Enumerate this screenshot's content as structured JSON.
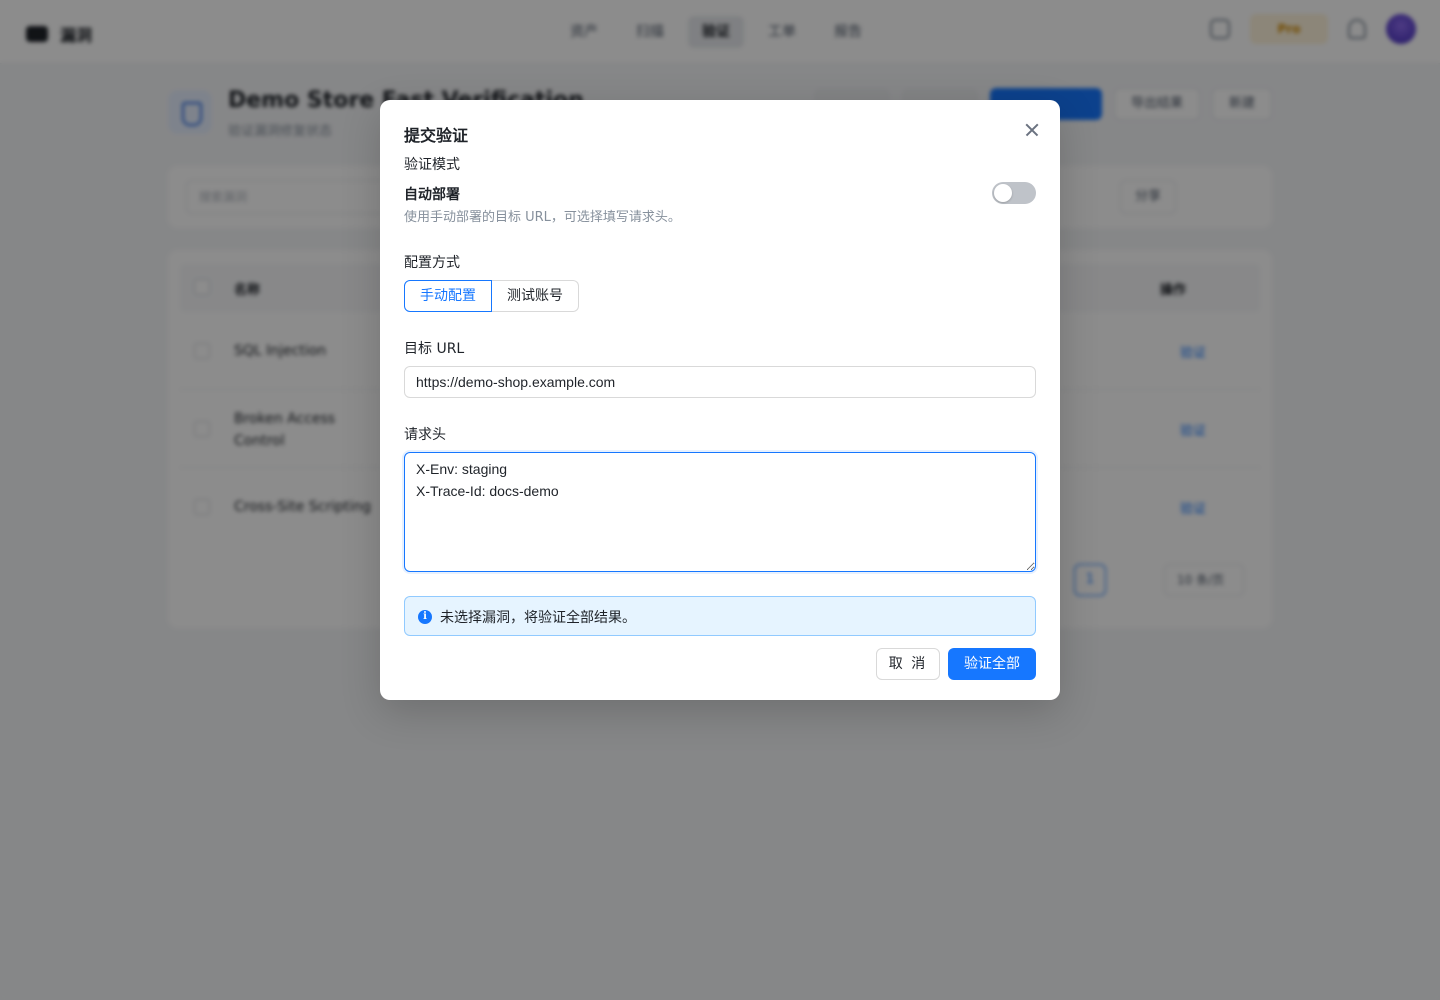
{
  "background": {
    "app_name": "漏洞",
    "nav": [
      "资产",
      "扫描",
      "验证",
      "工单",
      "报告"
    ],
    "nav_active": 2,
    "pro_label": "Pro",
    "page_title": "Demo Store Fast Verification",
    "page_subtitle": "验证漏洞修复状态",
    "export_label": "导出结果",
    "new_label": "新建",
    "search_placeholder": "搜索漏洞",
    "share_label": "分享",
    "table_header_name": "名称",
    "table_header_action": "操作",
    "rows": [
      {
        "name": "SQL Injection",
        "action": "验证"
      },
      {
        "name": "Broken Access Control",
        "action": "验证"
      },
      {
        "name": "Cross-Site Scripting",
        "action": "验证"
      }
    ],
    "current_page": "1",
    "page_size": "10 条/页"
  },
  "modal": {
    "title": "提交验证",
    "mode_section_label": "验证模式",
    "mode_name": "自动部署",
    "mode_description": "使用手动部署的目标 URL，可选择填写请求头。",
    "auto_deploy_enabled": false,
    "config_label": "配置方式",
    "config_options": [
      "手动配置",
      "测试账号"
    ],
    "config_selected": "手动配置",
    "url_label": "目标 URL",
    "url_value": "https://demo-shop.example.com",
    "headers_label": "请求头",
    "headers_value": "X-Env: staging\nX-Trace-Id: docs-demo",
    "info_text": "未选择漏洞，将验证全部结果。",
    "cancel_label": "取 消",
    "submit_label": "验证全部"
  },
  "colors": {
    "primary": "#1677ff",
    "info_bg": "#e6f4ff",
    "mask": "rgba(0,0,0,0.45)"
  },
  "icons": {
    "close": "close-icon",
    "info": "info-icon"
  }
}
